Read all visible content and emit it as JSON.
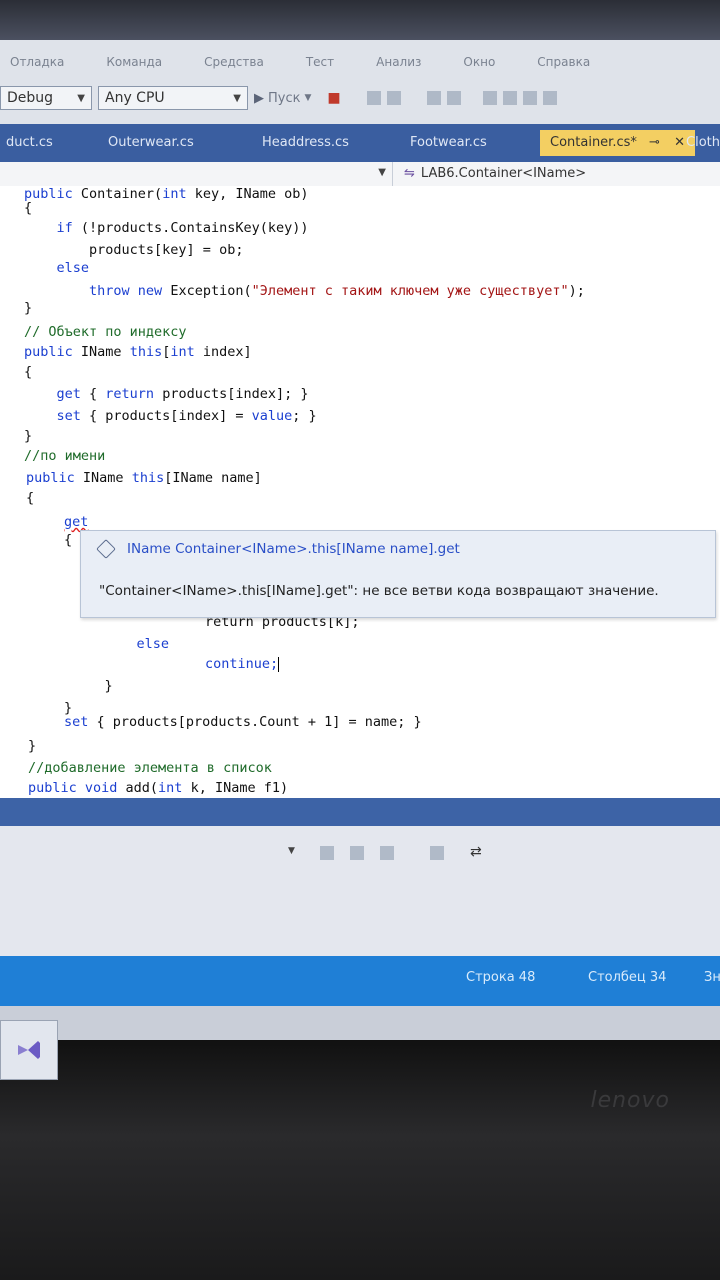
{
  "menu": [
    "Отладка",
    "Команда",
    "Средства",
    "Тест",
    "Анализ",
    "Окно",
    "Справка"
  ],
  "toolbar": {
    "config": "Debug",
    "platform": "Any CPU",
    "start": "Пуск"
  },
  "tabs": [
    {
      "label": "duct.cs",
      "active": false
    },
    {
      "label": "Outerwear.cs",
      "active": false
    },
    {
      "label": "Headdress.cs",
      "active": false
    },
    {
      "label": "Footwear.cs",
      "active": false
    },
    {
      "label": "Container.cs*",
      "active": true
    },
    {
      "label": "Cloth",
      "active": false
    }
  ],
  "navigation": {
    "member": "LAB6.Container<IName>"
  },
  "code": {
    "l1": "public Container(int key, IName ob)",
    "l2": "{",
    "l3": "    if (!products.ContainsKey(key))",
    "l4": "        products[key] = ob;",
    "l5": "    else",
    "l6": "        throw new Exception(\"Элемент с таким ключем уже существует\");",
    "l7": "}",
    "l8": "// Объект по индексу",
    "l9": "public IName this[int index]",
    "l10": "{",
    "l11": "    get { return products[index]; }",
    "l12": "    set { products[index] = value; }",
    "l13": "}",
    "l14": "//по имени",
    "l15": "public IName this[IName name]",
    "l16": "{",
    "l17": "get",
    "l18": "{",
    "l19": "        return products[k];",
    "l20": "    else",
    "l21": "        continue;",
    "l22": "    }",
    "l23": "}",
    "l24": "set { products[products.Count + 1] = name; }",
    "l25": "}",
    "l26": "//добавление элемента в список",
    "l27": "public void add(int k, IName f1)"
  },
  "tooltip": {
    "signature": "IName Container<IName>.this[IName name].get",
    "message": "\"Container<IName>.this[IName].get\": не все ветви кода возвращают значение."
  },
  "status": {
    "line": "Строка 48",
    "column": "Столбец 34",
    "extra": "Зн"
  },
  "brand": "lenovo",
  "colors": {
    "tab_active": "#f3cf62",
    "tabstrip": "#3a5ea0",
    "statusbar": "#1f7fd6",
    "keyword": "#1b3fd0"
  }
}
